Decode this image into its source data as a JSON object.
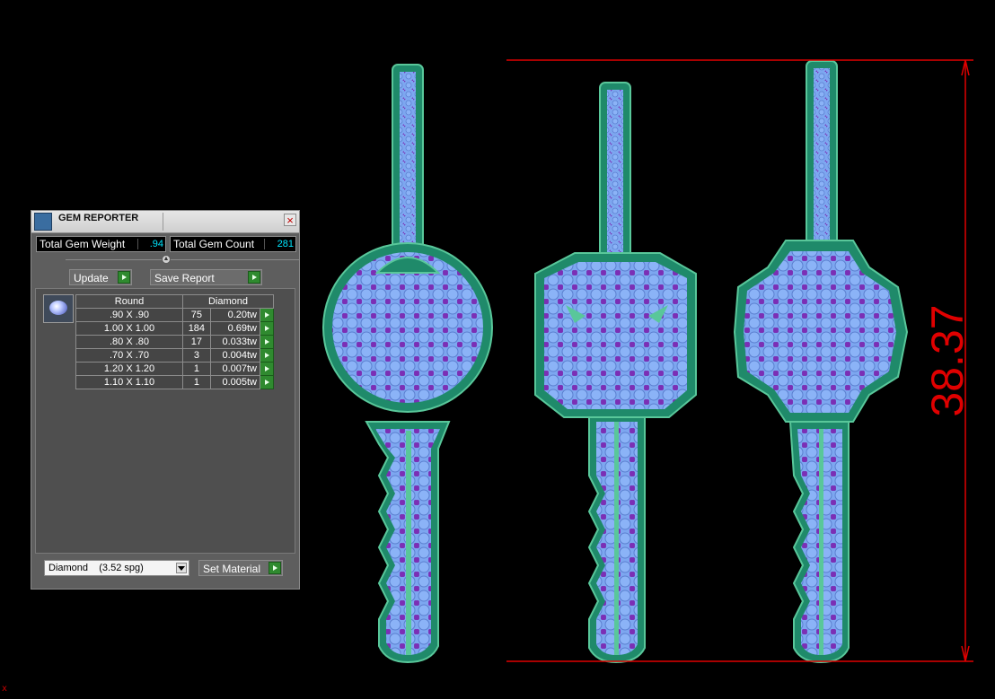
{
  "gem_reporter": {
    "title": "GEM REPORTER",
    "close_label": "×",
    "total_gem_weight_label": "Total Gem Weight",
    "total_gem_weight_value": ".94",
    "total_gem_count_label": "Total Gem Count",
    "total_gem_count_value": "281",
    "update_label": "Update",
    "save_report_label": "Save Report",
    "table": {
      "headers": [
        "Round",
        "Diamond"
      ],
      "rows": [
        {
          "size": ".90 X .90",
          "count": "75",
          "weight": "0.20tw"
        },
        {
          "size": "1.00 X 1.00",
          "count": "184",
          "weight": "0.69tw"
        },
        {
          "size": ".80 X .80",
          "count": "17",
          "weight": "0.033tw"
        },
        {
          "size": ".70 X .70",
          "count": "3",
          "weight": "0.004tw"
        },
        {
          "size": "1.20 X 1.20",
          "count": "1",
          "weight": "0.007tw"
        },
        {
          "size": "1.10 X 1.10",
          "count": "1",
          "weight": "0.005tw"
        }
      ]
    },
    "material_selected": "Diamond    (3.52 spg)",
    "set_material_label": "Set Material"
  },
  "viewport": {
    "dimension_label": "38.37",
    "axis_label": "x",
    "colors": {
      "background": "#000000",
      "metal": "#1f8a6a",
      "metal_light": "#59c79a",
      "gem": "#7da7f0",
      "gem_dot": "#7b2fb5",
      "dimension": "#e00000"
    }
  }
}
